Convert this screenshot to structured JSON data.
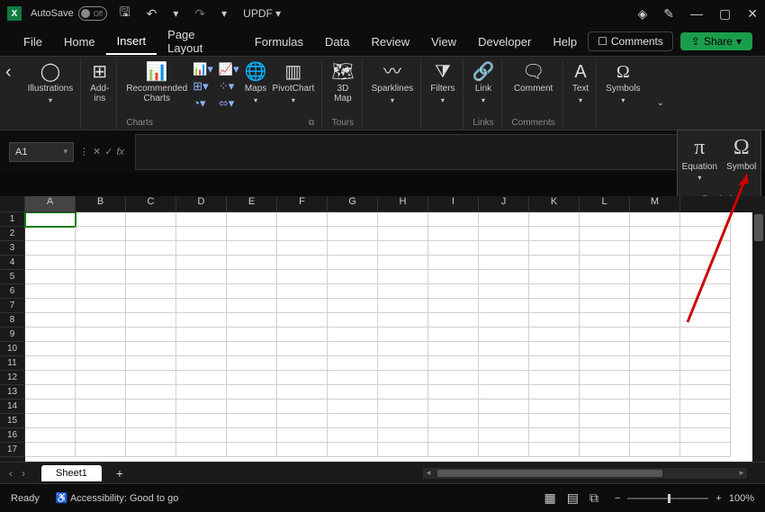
{
  "titlebar": {
    "autosave": "AutoSave",
    "autosave_state": "Off",
    "doc": "UPDF"
  },
  "tabs": [
    "File",
    "Home",
    "Insert",
    "Page Layout",
    "Formulas",
    "Data",
    "Review",
    "View",
    "Developer",
    "Help"
  ],
  "active_tab": "Insert",
  "buttons": {
    "comments": "Comments",
    "share": "Share"
  },
  "ribbon": {
    "illustrations": "Illustrations",
    "addins": "Add-\nins",
    "recommended": "Recommended\nCharts",
    "maps": "Maps",
    "pivotchart": "PivotChart",
    "map3d": "3D\nMap",
    "sparklines": "Sparklines",
    "filters": "Filters",
    "link": "Link",
    "comment": "Comment",
    "text": "Text",
    "symbols": "Symbols",
    "charts": "Charts",
    "tours": "Tours",
    "links": "Links",
    "comments": "Comments"
  },
  "flyout": {
    "equation": "Equation",
    "symbol": "Symbol",
    "label": "Symbols"
  },
  "namebox": "A1",
  "columns": [
    "A",
    "B",
    "C",
    "D",
    "E",
    "F",
    "G",
    "H",
    "I",
    "J",
    "K",
    "L",
    "M"
  ],
  "sheet": "Sheet1",
  "status": {
    "ready": "Ready",
    "accessibility": "Accessibility: Good to go",
    "zoom": "100%"
  }
}
